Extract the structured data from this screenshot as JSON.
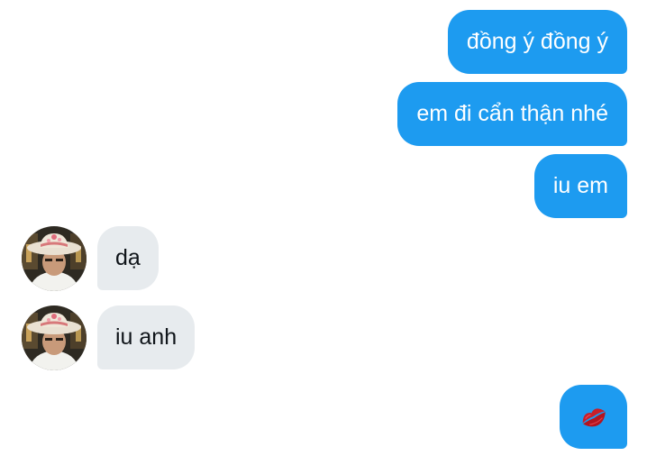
{
  "conversation": {
    "messages": [
      {
        "direction": "sent",
        "text": "đồng ý đồng ý"
      },
      {
        "direction": "sent",
        "text": "em đi cẩn thận nhé"
      },
      {
        "direction": "sent",
        "text": "iu em"
      },
      {
        "direction": "received",
        "text": "dạ"
      },
      {
        "direction": "received",
        "text": "iu anh"
      },
      {
        "direction": "sent",
        "text": "",
        "emoji": "kiss-mark-icon"
      }
    ]
  },
  "colors": {
    "sent_bubble": "#1d9bf0",
    "received_bubble": "#e7ebee",
    "sent_text": "#ffffff",
    "received_text": "#0f1419"
  }
}
